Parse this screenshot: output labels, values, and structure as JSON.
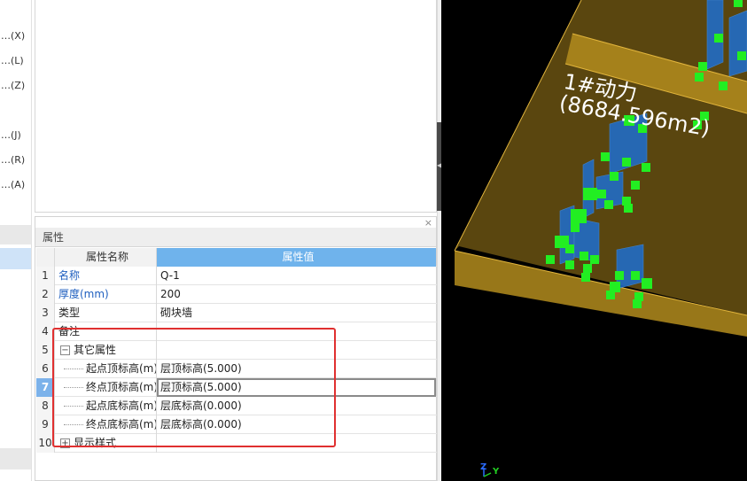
{
  "left_menu": {
    "items": [
      "…(X)",
      "…(L)",
      "…(Z)",
      "…(J)",
      "…(R)",
      "…(A)"
    ]
  },
  "properties": {
    "title": "属性",
    "close_glyph": "×",
    "columns": {
      "num": "",
      "name": "属性名称",
      "value": "属性值"
    },
    "rows": [
      {
        "num": "1",
        "name": "名称",
        "value": "Q-1"
      },
      {
        "num": "2",
        "name": "厚度(mm)",
        "value": "200"
      },
      {
        "num": "3",
        "name": "类型",
        "value": "砌块墙"
      },
      {
        "num": "4",
        "name": "备注",
        "value": ""
      },
      {
        "num": "5",
        "name": "其它属性",
        "value": "",
        "expander": "−"
      },
      {
        "num": "6",
        "name": "起点顶标高(m)",
        "value": "层顶标高(5.000)"
      },
      {
        "num": "7",
        "name": "终点顶标高(m)",
        "value": "层顶标高(5.000)"
      },
      {
        "num": "8",
        "name": "起点底标高(m)",
        "value": "层底标高(0.000)"
      },
      {
        "num": "9",
        "name": "终点底标高(m)",
        "value": "层底标高(0.000)"
      },
      {
        "num": "10",
        "name": "显示样式",
        "value": "",
        "expander": "+"
      }
    ]
  },
  "viewport": {
    "region_name": "1#动力",
    "region_area": "(8684.596m2)",
    "axis_z": "Z",
    "axis_y": "Y",
    "colors": {
      "slab": "#b8901e",
      "slab_edge": "#e2b53c",
      "wall": "#1e6fd0",
      "markers": "#22ee22"
    }
  }
}
